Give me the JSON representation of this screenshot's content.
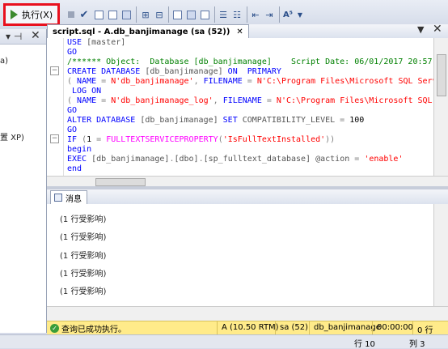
{
  "toolbar": {
    "execute_label": "执行(X)"
  },
  "left_panel": {
    "fragment_a": "a)",
    "fragment_xp": "置 XP)"
  },
  "editor": {
    "tab_title": "script.sql - A.db_banjimanage (sa (52))",
    "lines": [
      "USE [master]",
      "GO",
      "/****** Object:  Database [db_banjimanage]    Script Date: 06/01/2017 20:57",
      "CREATE DATABASE [db_banjimanage] ON  PRIMARY",
      "( NAME = N'db_banjimanage', FILENAME = N'C:\\Program Files\\Microsoft SQL Serv",
      " LOG ON",
      "( NAME = N'db_banjimanage_log', FILENAME = N'C:\\Program Files\\Microsoft SQL",
      "GO",
      "ALTER DATABASE [db_banjimanage] SET COMPATIBILITY_LEVEL = 100",
      "GO",
      "IF (1 = FULLTEXTSERVICEPROPERTY('IsFullTextInstalled'))",
      "begin",
      "EXEC [db_banjimanage].[dbo].[sp_fulltext_database] @action = 'enable'",
      "end"
    ]
  },
  "results": {
    "tab_label": "消息",
    "messages": [
      "(1 行受影响)",
      "(1 行受影响)",
      "(1 行受影响)",
      "(1 行受影响)",
      "(1 行受影响)"
    ]
  },
  "status": {
    "message": "查询已成功执行。",
    "server": "A (10.50 RTM)",
    "user": "sa (52)",
    "database": "db_banjimanage",
    "elapsed": "00:00:00",
    "rows": "0 行",
    "colors": {
      "bar": "#ffeb8a",
      "success": "#3a9d3a"
    }
  },
  "app_status": {
    "line": "行 10",
    "column": "列 3"
  },
  "highlight_color": "#e8101e"
}
